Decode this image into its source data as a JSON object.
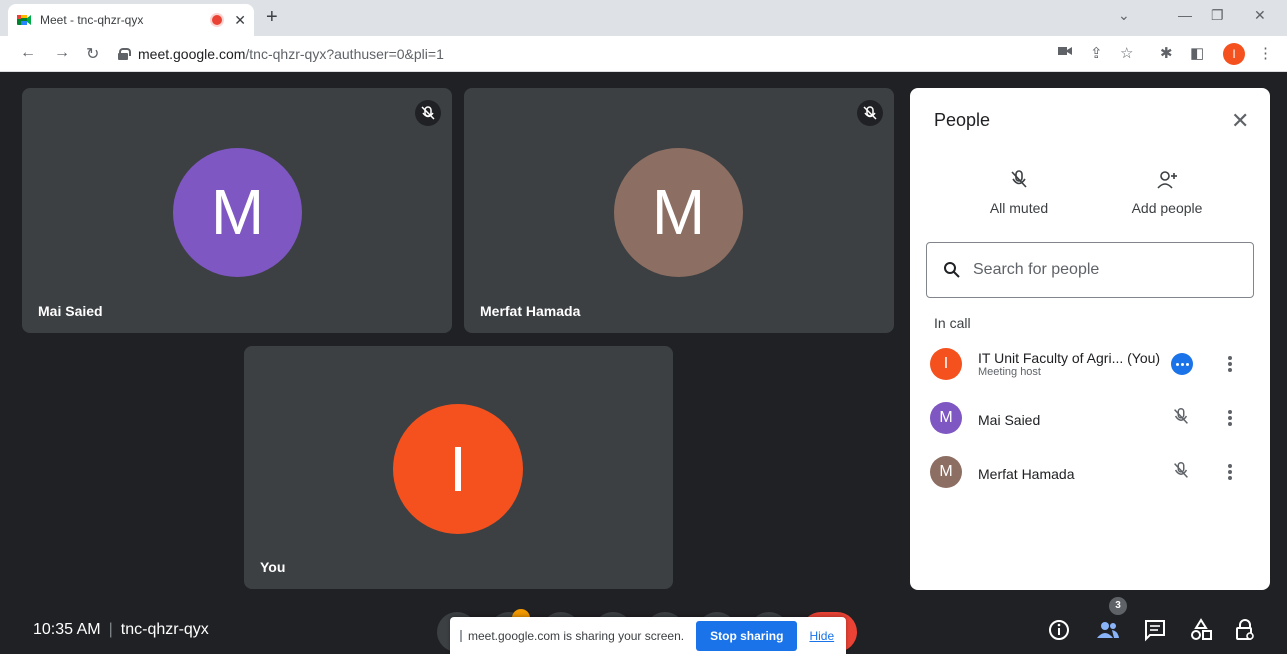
{
  "browser": {
    "tab_title": "Meet - tnc-qhzr-qyx",
    "url_host": "meet.google.com",
    "url_path": "/tnc-qhzr-qyx?authuser=0&pli=1",
    "profile_initial": "I"
  },
  "tiles": [
    {
      "name": "Mai Saied",
      "initial": "M",
      "color": "#7e57c2"
    },
    {
      "name": "Merfat Hamada",
      "initial": "M",
      "color": "#8d6e63"
    },
    {
      "name": "You",
      "initial": "I",
      "color": "#f4511e"
    }
  ],
  "panel": {
    "title": "People",
    "all_muted": "All muted",
    "add_people": "Add people",
    "search_placeholder": "Search for people",
    "in_call": "In call",
    "people": [
      {
        "initial": "I",
        "name": "IT Unit Faculty of Agri... (You)",
        "role": "Meeting host",
        "color": "#f4511e"
      },
      {
        "initial": "M",
        "name": "Mai Saied",
        "role": "",
        "color": "#7e57c2"
      },
      {
        "initial": "M",
        "name": "Merfat Hamada",
        "role": "",
        "color": "#8d6e63"
      }
    ]
  },
  "bottom": {
    "time": "10:35 AM",
    "separator": "|",
    "meeting_code": "tnc-qhzr-qyx",
    "people_count": "3"
  },
  "share_bar": {
    "message": "meet.google.com is sharing your screen.",
    "stop_label": "Stop sharing",
    "hide_label": "Hide"
  }
}
